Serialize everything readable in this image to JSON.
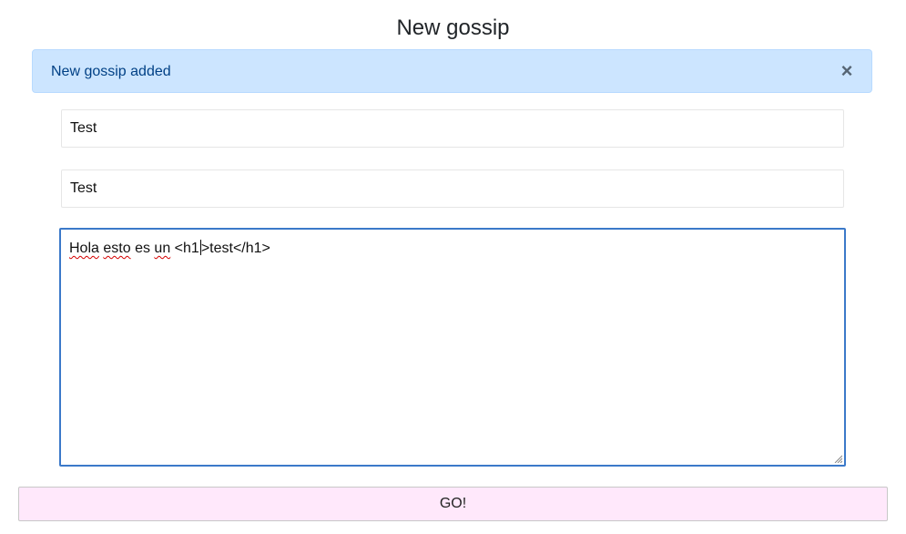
{
  "page": {
    "title": "New gossip"
  },
  "alert": {
    "message": "New gossip added",
    "close_symbol": "×",
    "background_color": "#cce5ff",
    "text_color": "#004085"
  },
  "form": {
    "field_1_value": "Test",
    "field_2_value": "Test",
    "textarea": {
      "word_1": "Hola",
      "word_2": "esto",
      "word_3": "es",
      "word_4": "un",
      "before_caret": "<h1",
      "after_caret": ">test</h1>"
    },
    "submit_label": "GO!",
    "submit_color": "#ffe8fb",
    "focus_color": "#3b79c9"
  }
}
